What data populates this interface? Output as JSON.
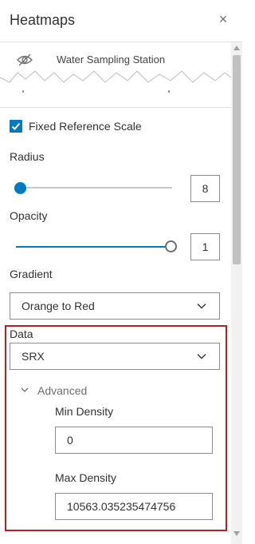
{
  "panel": {
    "title": "Heatmaps",
    "close_symbol": "×"
  },
  "layer": {
    "name": "Water Sampling Station",
    "visibility_icon": "eye-off-icon"
  },
  "fixed_reference_scale": {
    "label": "Fixed Reference Scale",
    "checked": true
  },
  "radius": {
    "label": "Radius",
    "value": "8",
    "slider_level": 0.0
  },
  "opacity": {
    "label": "Opacity",
    "value": "1",
    "slider_level": 1.0
  },
  "gradient": {
    "label": "Gradient",
    "selected": "Orange to Red"
  },
  "data": {
    "label": "Data",
    "selected": "SRX"
  },
  "advanced": {
    "label": "Advanced",
    "min_density": {
      "label": "Min Density",
      "value": "0"
    },
    "max_density": {
      "label": "Max Density",
      "value": "10563.035235474756"
    }
  },
  "colors": {
    "accent": "#007ac2",
    "highlight_border": "#b0222a"
  }
}
